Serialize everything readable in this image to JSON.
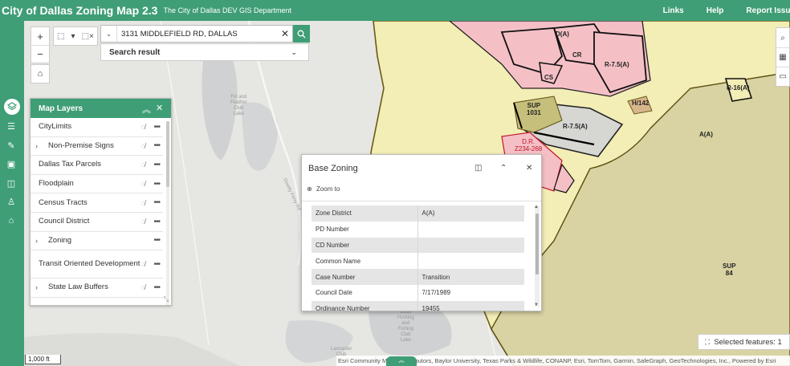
{
  "header": {
    "title": "City of Dallas Zoning Map 2.3",
    "subtitle": "The City of Dallas DEV GIS Department",
    "links": [
      "Links",
      "Help",
      "Report Issue"
    ]
  },
  "search": {
    "value": "3131 MIDDLEFIELD RD, DALLAS",
    "result_label": "Search result"
  },
  "layer_list": {
    "title": "Map Layers",
    "items": [
      {
        "label": "CityLimits",
        "expandable": false,
        "visible_toggle": true
      },
      {
        "label": "Non-Premise Signs",
        "expandable": true,
        "visible_toggle": true
      },
      {
        "label": "Dallas Tax Parcels",
        "expandable": false,
        "visible_toggle": true
      },
      {
        "label": "Floodplain",
        "expandable": false,
        "visible_toggle": true
      },
      {
        "label": "Census Tracts",
        "expandable": false,
        "visible_toggle": true
      },
      {
        "label": "Council District",
        "expandable": false,
        "visible_toggle": true
      },
      {
        "label": "Zoning",
        "expandable": true,
        "visible_toggle": false
      },
      {
        "label": "Transit Oriented Development",
        "expandable": false,
        "visible_toggle": true
      },
      {
        "label": "State Law Buffers",
        "expandable": true,
        "visible_toggle": true
      }
    ]
  },
  "popup": {
    "title": "Base Zoning",
    "zoom_to": "Zoom to",
    "rows": [
      {
        "field": "Zone District",
        "value": "A(A)"
      },
      {
        "field": "PD Number",
        "value": ""
      },
      {
        "field": "CD Number",
        "value": ""
      },
      {
        "field": "Common Name",
        "value": ""
      },
      {
        "field": "Case Number",
        "value": "Transition"
      },
      {
        "field": "Council Date",
        "value": "7/17/1989"
      },
      {
        "field": "Ordinance Number",
        "value": "19455"
      }
    ]
  },
  "map_labels": {
    "da": "D(A)",
    "cr": "CR",
    "r75a_top": "R-7.5(A)",
    "cs": "CS",
    "sup1031": "SUP\n1031",
    "h142": "H/142",
    "r16a": "R-16(A)",
    "r75a_mid": "R-7.5(A)",
    "aa": "A(A)",
    "dr": "D.R.\nZ234-268",
    "sup84": "SUP\n84",
    "lake1": "Fin and\nFeather\nClub\nLake",
    "road1": "Dowdy Ferry Rd",
    "lake2": "Duck\nHunting\nand\nFishing\nClub\nLake",
    "lake3": "Lancaster\nClub"
  },
  "scale": "1,000 ft",
  "attribution": "Esri Community Maps Contributors, Baylor University, Texas Parks & Wildlife, CONANP, Esri, TomTom, Garmin, SafeGraph, GeoTechnologies, Inc., Powered by Esri",
  "selected_features": "Selected features: 1",
  "colors": {
    "brand": "#3f9e76",
    "zoning_fill": "#f3edb6",
    "zoning_outline": "#6b5a12",
    "highlight_pink": "#f4c0c6",
    "water": "#cfd1d2"
  },
  "icons": {
    "appbar": [
      "layers-icon",
      "list-icon",
      "draw-icon",
      "print-icon",
      "database-icon",
      "person-icon",
      "store-icon"
    ],
    "map_tools": [
      "zoom-in-icon",
      "zoom-out-icon",
      "home-icon"
    ],
    "right_tools": [
      "search-icon",
      "qr-icon",
      "measure-icon"
    ]
  }
}
